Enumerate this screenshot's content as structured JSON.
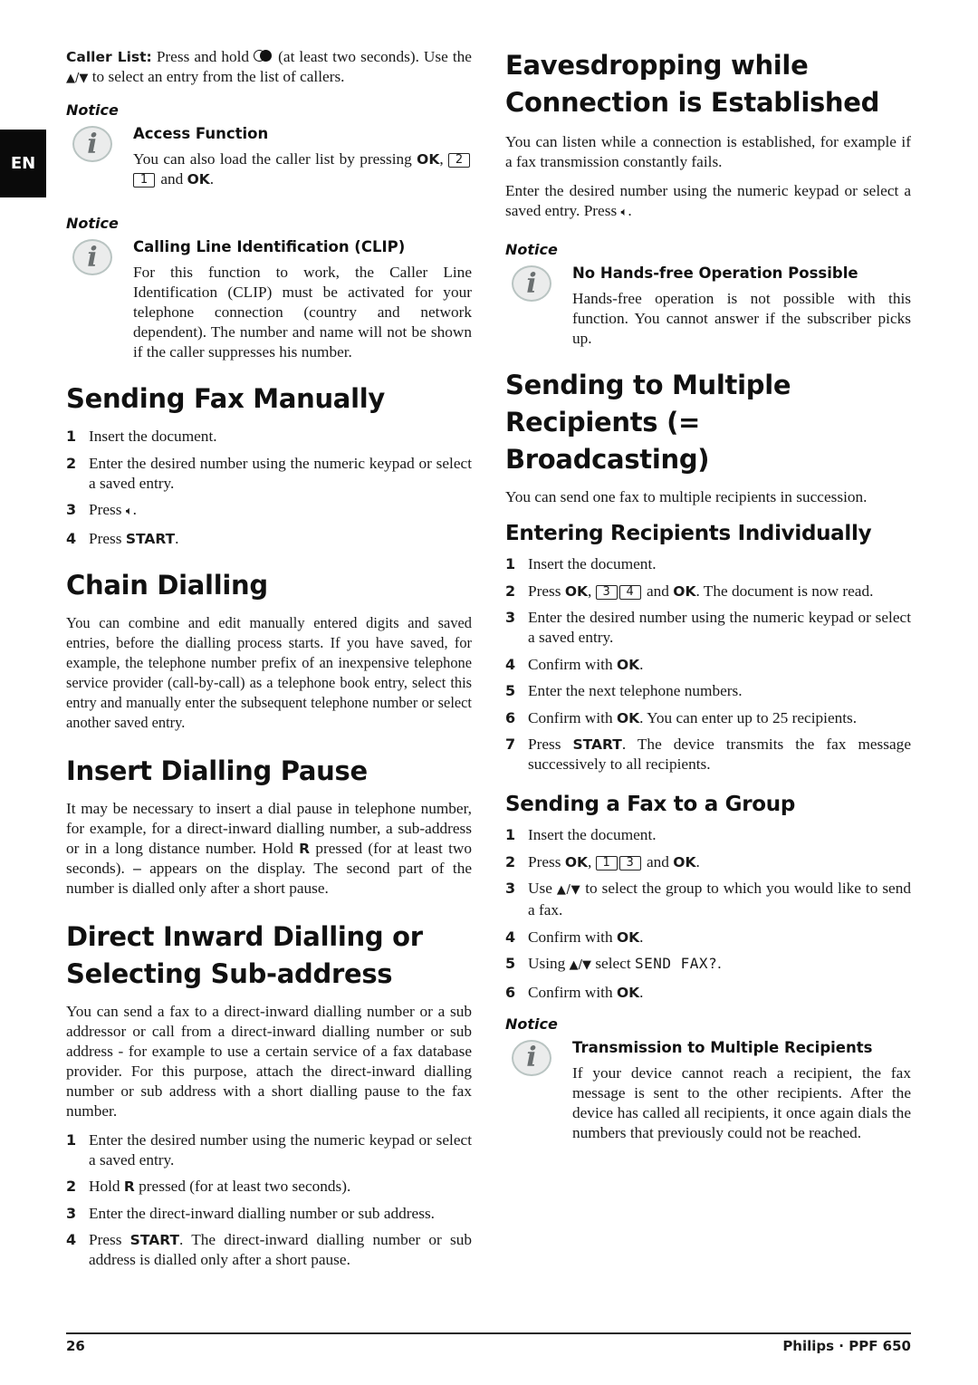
{
  "language_tab": "EN",
  "left": {
    "caller_list": {
      "label": "Caller List:",
      "text1": "Press and hold",
      "icon": "caller-list-icon",
      "text2": "(at least two seconds). Use the",
      "arrows": "▲/▼",
      "text3": "to select an entry from the list of callers."
    },
    "notice1": {
      "label": "Notice",
      "title": "Access Function",
      "text1": "You can also load the caller list by pressing",
      "ok1": "OK",
      "keys": [
        "2",
        "1"
      ],
      "text2": "and",
      "ok2": "OK",
      "end": "."
    },
    "notice2": {
      "label": "Notice",
      "title": "Calling Line Identification (CLIP)",
      "text": "For this function to work, the Caller Line Identification (CLIP) must be activated for your telephone connection (country and network dependent). The number and name will not be shown if the caller suppresses his number."
    },
    "sending_manually": {
      "heading": "Sending Fax Manually",
      "steps": [
        {
          "num": "1",
          "text": "Insert the document."
        },
        {
          "num": "2",
          "text": "Enter the desired number using the numeric keypad or select a saved entry."
        },
        {
          "num": "3",
          "pre": "Press",
          "icon": "speaker-icon",
          "post": "."
        },
        {
          "num": "4",
          "pre": "Press",
          "bold": "START",
          "post": "."
        }
      ]
    },
    "chain_dialling": {
      "heading": "Chain Dialling",
      "text": "You can combine and edit manually entered digits and saved entries, before the dialling process starts. If you have saved, for example, the telephone number prefix of an inexpensive telephone service provider (call-by-call) as a telephone book entry, select this entry and manually enter the subsequent telephone number or select another saved entry."
    },
    "dialling_pause": {
      "heading": "Insert Dialling Pause",
      "text1": "It may be necessary to insert a dial pause in telephone number, for example, for a direct-inward dialling number, a sub-address or in a long distance number. Hold",
      "key": "R",
      "text2": "pressed (for at least two seconds).",
      "symbol": "–",
      "text3": "appears on the display. The second part of the number is dialled only after a short pause."
    },
    "direct_inward": {
      "heading": "Direct Inward Dialling or Selecting Sub-address",
      "text": "You can send a fax to a direct-inward dialling number or a sub addressor or call from a direct-inward dialling number or sub address - for example to use a certain service of a fax database provider. For this purpose, attach the direct-inward dialling number or sub address with a short dialling pause to the fax number.",
      "steps": [
        {
          "num": "1",
          "text": "Enter the desired number using the numeric keypad or select a saved entry."
        },
        {
          "num": "2",
          "pre": "Hold",
          "bold": "R",
          "post": "pressed (for at least two seconds)."
        },
        {
          "num": "3",
          "text": "Enter the direct-inward dialling number or sub address."
        },
        {
          "num": "4",
          "pre": "Press",
          "bold": "START",
          "post": ". The direct-inward dialling number or sub address is dialled only after a short pause."
        }
      ]
    }
  },
  "right": {
    "eavesdropping": {
      "heading": "Eavesdropping while Connection is Established",
      "text1": "You can listen while a connection is established, for example if a fax transmission constantly fails.",
      "text2": "Enter the desired number using the numeric keypad or select a saved entry. Press",
      "icon": "speaker-icon",
      "end": "."
    },
    "notice3": {
      "label": "Notice",
      "title": "No Hands-free Operation Possible",
      "text": "Hands-free operation is not possible with this function. You cannot answer if the subscriber picks up."
    },
    "broadcasting": {
      "heading": "Sending to Multiple Recipients (= Broadcasting)",
      "text": "You can send one fax to multiple recipients in succession."
    },
    "individually": {
      "heading": "Entering Recipients Individually",
      "steps": [
        {
          "num": "1",
          "text": "Insert the document."
        },
        {
          "num": "2",
          "pre": "Press",
          "ok1": "OK",
          "keys": [
            "3",
            "4"
          ],
          "mid": "and",
          "ok2": "OK",
          "post": ". The document is now read."
        },
        {
          "num": "3",
          "text": "Enter the desired number using the numeric keypad or select a saved entry."
        },
        {
          "num": "4",
          "pre": "Confirm with",
          "bold": "OK",
          "post": "."
        },
        {
          "num": "5",
          "text": "Enter the next telephone numbers."
        },
        {
          "num": "6",
          "pre": "Confirm with",
          "bold": "OK",
          "post": ". You can enter up to 25 recipients."
        },
        {
          "num": "7",
          "pre": "Press",
          "bold": "START",
          "post": ". The device transmits the fax message successively to all recipients."
        }
      ]
    },
    "group": {
      "heading": "Sending a Fax to a Group",
      "steps": [
        {
          "num": "1",
          "text": "Insert the document."
        },
        {
          "num": "2",
          "pre": "Press",
          "ok1": "OK",
          "keys": [
            "1",
            "3"
          ],
          "mid": "and",
          "ok2": "OK",
          "post": "."
        },
        {
          "num": "3",
          "pre": "Use",
          "arrows": "▲/▼",
          "post": "to select the group to which you would like to send a fax."
        },
        {
          "num": "4",
          "pre": "Confirm with",
          "bold": "OK",
          "post": "."
        },
        {
          "num": "5",
          "pre": "Using",
          "arrows": "▲/▼",
          "mid": "select",
          "lcd": "SEND FAX?",
          "post": "."
        },
        {
          "num": "6",
          "pre": "Confirm with",
          "bold": "OK",
          "post": "."
        }
      ]
    },
    "notice4": {
      "label": "Notice",
      "title": "Transmission to Multiple Recipients",
      "text": "If your device cannot reach a recipient, the fax message is sent to the other recipients. After the device has called all recipients, it once again dials the numbers that previously could not be reached."
    }
  },
  "footer": {
    "page_number": "26",
    "product": "Philips · PPF 650"
  }
}
